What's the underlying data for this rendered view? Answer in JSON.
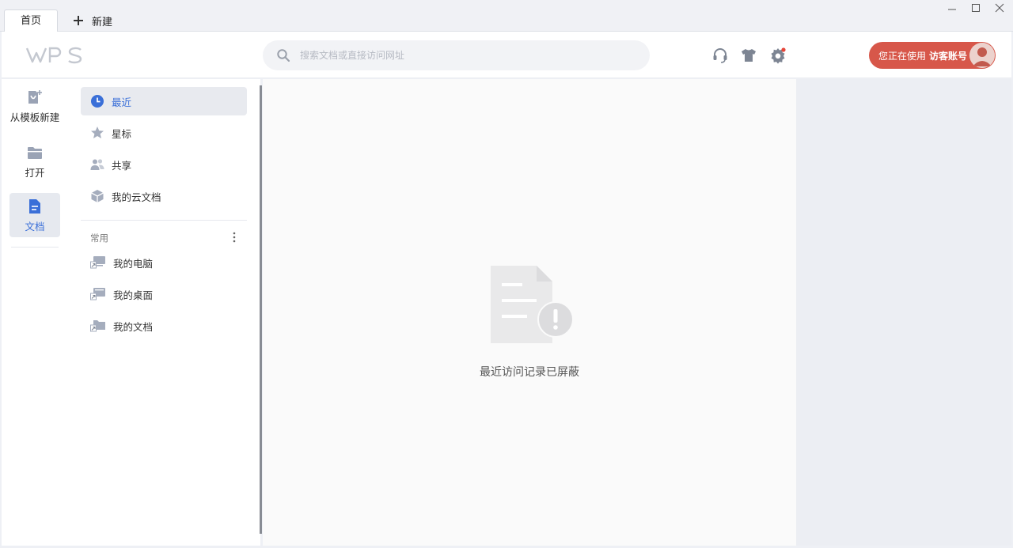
{
  "tabs": {
    "home_label": "首页",
    "new_label": "新建"
  },
  "header": {
    "logo_text": "WPS",
    "search_placeholder": "搜索文档或直接访问网址",
    "account_prefix": "您正在使用",
    "account_name": "访客账号"
  },
  "rail": {
    "items": [
      {
        "label": "从模板新建",
        "icon": "template-new-icon"
      },
      {
        "label": "打开",
        "icon": "folder-open-icon"
      },
      {
        "label": "文档",
        "icon": "document-icon",
        "active": true
      }
    ]
  },
  "nav": {
    "items": [
      {
        "label": "最近",
        "icon": "clock-icon",
        "active": true
      },
      {
        "label": "星标",
        "icon": "star-icon"
      },
      {
        "label": "共享",
        "icon": "people-icon"
      },
      {
        "label": "我的云文档",
        "icon": "cloud-box-icon"
      }
    ],
    "section_label": "常用",
    "frequent": [
      {
        "label": "我的电脑",
        "icon": "computer-shortcut-icon"
      },
      {
        "label": "我的桌面",
        "icon": "desktop-shortcut-icon"
      },
      {
        "label": "我的文档",
        "icon": "folder-shortcut-icon"
      }
    ]
  },
  "content": {
    "empty_message": "最近访问记录已屏蔽"
  },
  "colors": {
    "accent": "#3a6fd8",
    "account_button": "#d7574a",
    "notification_dot": "#e5463a"
  }
}
